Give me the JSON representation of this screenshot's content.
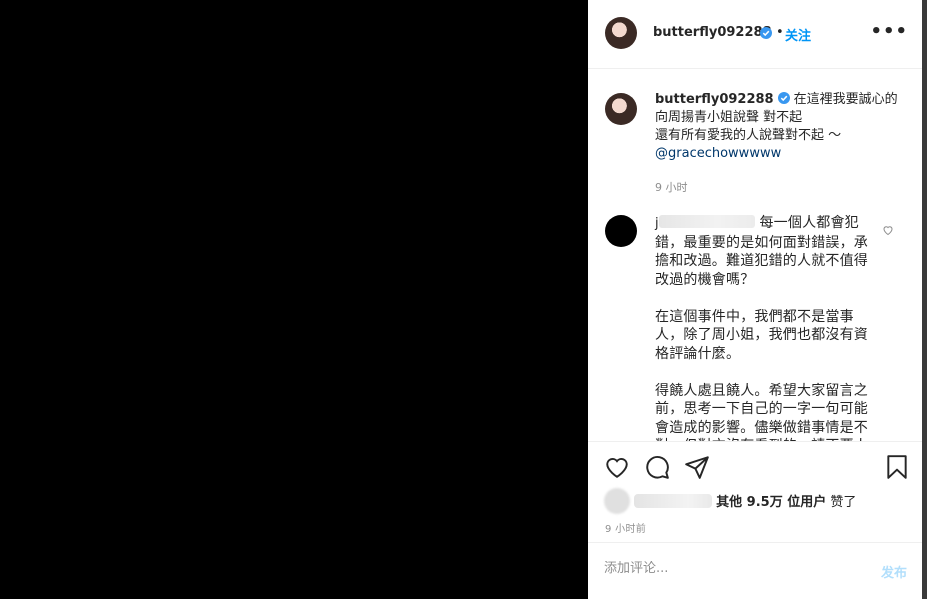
{
  "header": {
    "username": "butterfly092288",
    "verified_icon": "verified-badge-icon",
    "separator": "•",
    "follow_label": "关注",
    "more_label": "•••"
  },
  "caption": {
    "username": "butterfly092288",
    "text": "在這裡我要誠心的向周揚青小姐說聲 對不起",
    "text2": "還有所有愛我的人說聲對不起 ～",
    "mention": "@gracechowwwww",
    "time": "9 小时"
  },
  "comment": {
    "username_visible": "j",
    "para1": "每一個人都會犯錯，最重要的是如何面對錯誤，承擔和改過。難道犯錯的人就不值得改過的機會嗎？",
    "para2": "在這個事件中，我們都不是當事人，除了周小姐，我們也都沒有資格評論什麼。",
    "para3": "得饒人處且饒人。希望大家留言之前，思考一下自己的一字一句可能會造成的影響。儘樂做錯事情是不對，但對方沒有看到的，請不要人身攻擊。"
  },
  "actions": {
    "likes_prefix": "",
    "likes_bold": "其他 9.5万 位用户",
    "likes_suffix": " 赞了",
    "posted_ago": "9 小时前"
  },
  "comment_box": {
    "placeholder": "添加评论...",
    "post_label": "发布"
  },
  "colors": {
    "accent": "#0095f6",
    "post_disabled": "#b2dffc",
    "muted": "#8e8e8e"
  }
}
